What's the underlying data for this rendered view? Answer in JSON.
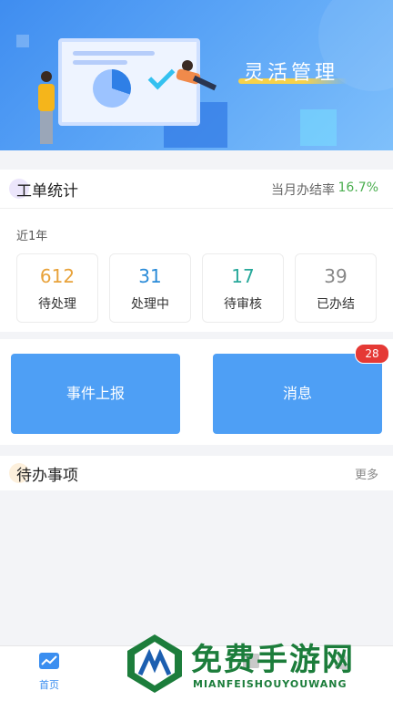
{
  "banner": {
    "title": "灵活管理"
  },
  "work_orders": {
    "title": "工单统计",
    "monthly_rate_label": "当月办结率",
    "monthly_rate_value": "16.7%",
    "period": "近1年",
    "stats": [
      {
        "value": "612",
        "label": "待处理",
        "color": "#e8a23a"
      },
      {
        "value": "31",
        "label": "处理中",
        "color": "#2a8bd8"
      },
      {
        "value": "17",
        "label": "待审核",
        "color": "#27a89a"
      },
      {
        "value": "39",
        "label": "已办结",
        "color": "#888888"
      }
    ]
  },
  "actions": {
    "report_label": "事件上报",
    "message_label": "消息",
    "message_badge": "28"
  },
  "todo": {
    "title": "待办事项",
    "more_label": "更多"
  },
  "tabbar": {
    "home_label": "首页",
    "active_color": "#3a8ef0"
  },
  "watermark": {
    "text": "免费手游网",
    "sub": "MIANFEISHOUYOUWANG"
  }
}
